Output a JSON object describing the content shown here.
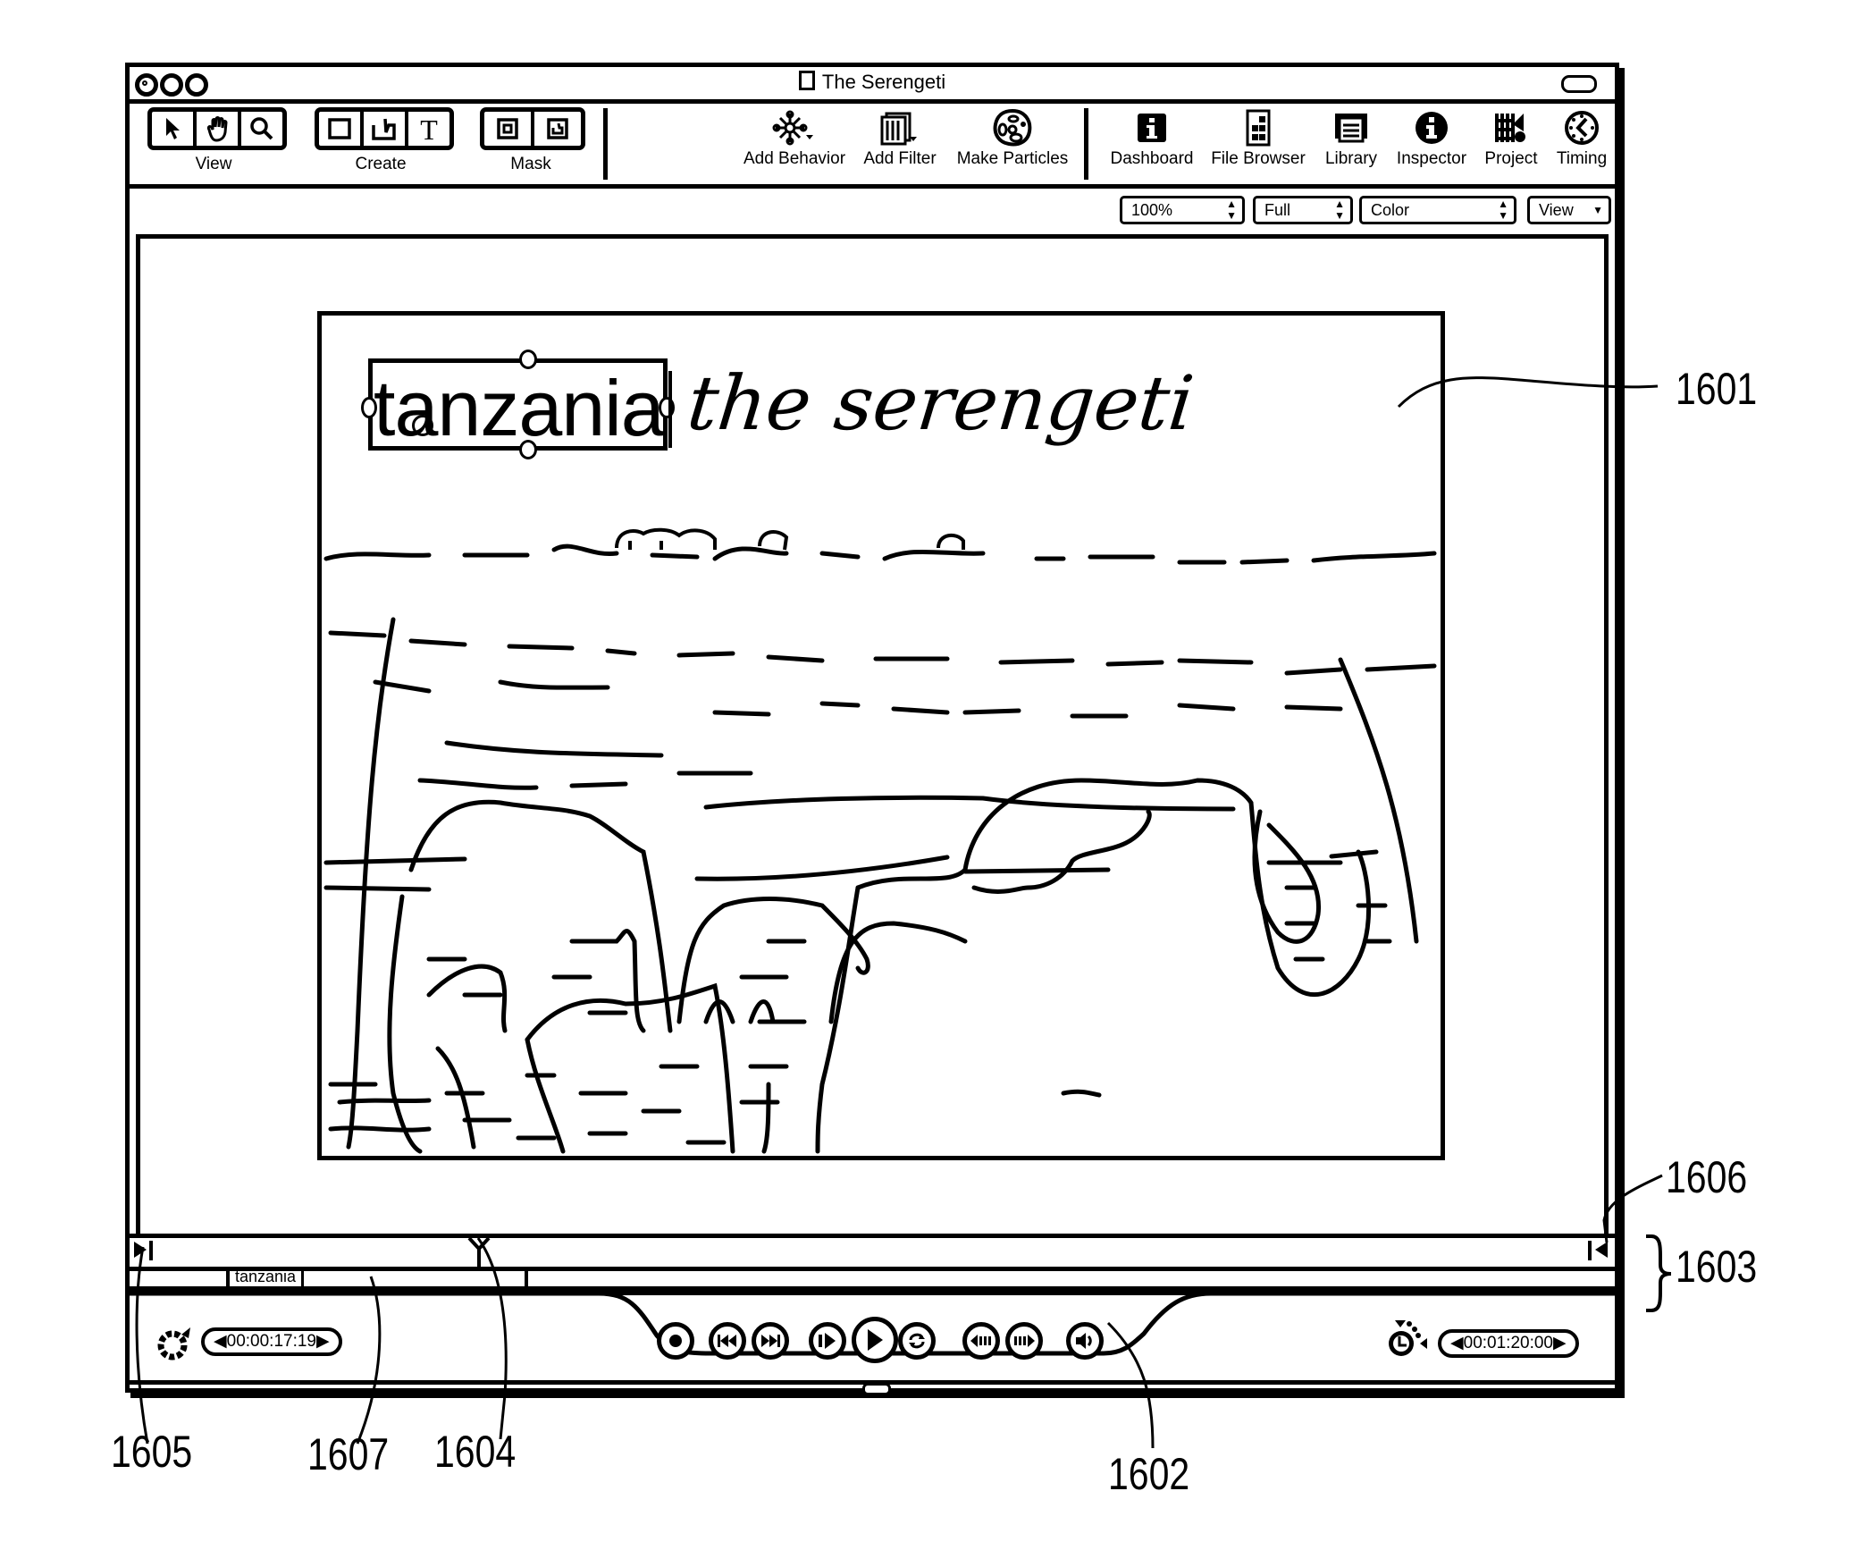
{
  "window": {
    "title": "The Serengeti",
    "traffic_lights": [
      "close",
      "minimize",
      "zoom"
    ]
  },
  "toolbar": {
    "groups": [
      {
        "label": "View",
        "tools": [
          "arrow-select-icon",
          "hand-pan-icon",
          "magnifier-zoom-icon"
        ]
      },
      {
        "label": "Create",
        "tools": [
          "rectangle-icon",
          "bezier-pen-icon",
          "text-tool-icon"
        ]
      },
      {
        "label": "Mask",
        "tools": [
          "rectangle-mask-icon",
          "bezier-mask-icon"
        ]
      }
    ],
    "actions": [
      {
        "label": "Add Behavior",
        "icon": "behavior-gear-icon"
      },
      {
        "label": "Add Filter",
        "icon": "filter-icon"
      },
      {
        "label": "Make Particles",
        "icon": "particles-icon"
      }
    ],
    "panels": [
      {
        "label": "Dashboard",
        "icon": "dashboard-icon"
      },
      {
        "label": "File Browser",
        "icon": "file-browser-icon"
      },
      {
        "label": "Library",
        "icon": "library-icon"
      },
      {
        "label": "Inspector",
        "icon": "inspector-icon"
      },
      {
        "label": "Project",
        "icon": "project-icon"
      },
      {
        "label": "Timing",
        "icon": "timing-clock-icon"
      }
    ]
  },
  "viewer_options": {
    "zoom": "100%",
    "resolution": "Full",
    "channels": "Color",
    "view_menu": "View"
  },
  "canvas": {
    "selected_text": "tanzania",
    "title_text": "the serengeti"
  },
  "timeline": {
    "layer_label": "tanzania"
  },
  "transport": {
    "current_time": "00:00:17:19",
    "duration": "00:01:20:00",
    "buttons": [
      "record",
      "go-to-start",
      "go-to-end",
      "play-from-start",
      "play",
      "loop",
      "previous-frame",
      "next-frame",
      "audio"
    ]
  },
  "annotations": {
    "canvas_ref": "1601",
    "transport_ref": "1602",
    "timeline_ref": "1603",
    "playhead_ref": "1604",
    "play_range_start_ref": "1605",
    "play_range_end_ref": "1606",
    "layer_bar_ref": "1607"
  }
}
